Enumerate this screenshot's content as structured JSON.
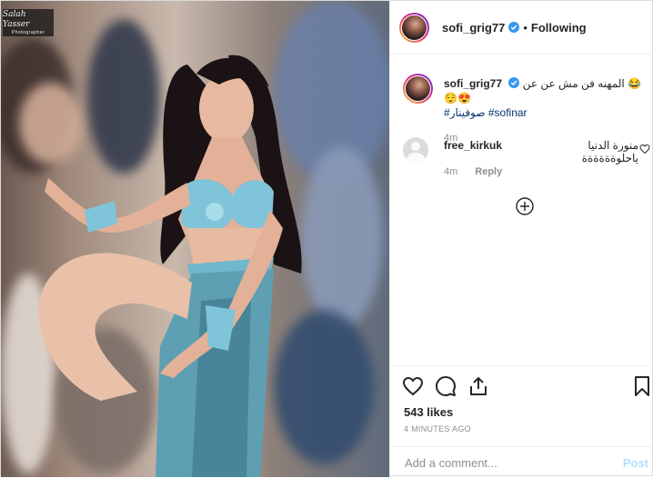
{
  "photo": {
    "watermark_main": "Salah Yasser",
    "watermark_sub": "Photographer"
  },
  "header": {
    "username": "sofi_grig77",
    "separator": "•",
    "follow_status": "Following"
  },
  "caption": {
    "username": "sofi_grig77",
    "text": "المهنه فن مش عن عن 😂😌😍",
    "hashtags": "#صوفينار #sofinar",
    "time": "4m"
  },
  "comments": [
    {
      "username": "free_kirkuk",
      "text": "منورة الدنيا ياحلوةةةةةة",
      "time": "4m",
      "reply_label": "Reply"
    }
  ],
  "stats": {
    "likes": "543 likes",
    "timestamp": "4 MINUTES AGO"
  },
  "add_comment": {
    "placeholder": "Add a comment...",
    "post_label": "Post"
  },
  "colors": {
    "verified_blue": "#3897f0",
    "text_primary": "#262626",
    "text_secondary": "#8e8e8e",
    "post_disabled": "#b2dffc"
  },
  "icons": [
    "verified-badge-icon",
    "heart-icon",
    "comment-icon",
    "share-icon",
    "bookmark-icon",
    "plus-circle-icon"
  ]
}
